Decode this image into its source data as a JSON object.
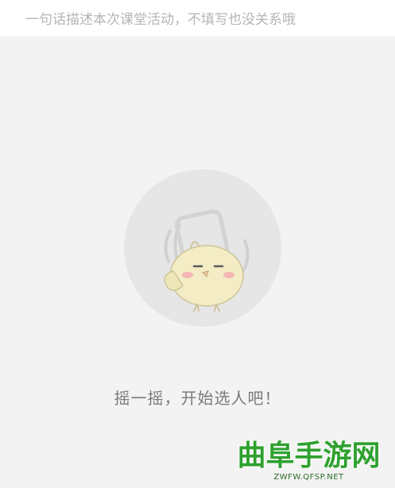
{
  "header": {
    "description_placeholder": "一句话描述本次课堂活动，不填写也没关系哦",
    "description_value": ""
  },
  "main": {
    "shake_icon": "shaking-chick-icon",
    "prompt_text": "摇一摇，开始选人吧！"
  },
  "watermark": {
    "title": "曲阜手游网",
    "url": "ZWFW.QFSP.NET"
  },
  "colors": {
    "background": "#f3f3f3",
    "header_background": "#ffffff",
    "circle": "#e6e6e6",
    "chick_body": "#f3ecc4",
    "cheek": "#f6b6b6",
    "prompt_text": "#7a7a7a",
    "watermark_green": "#2fa12f"
  }
}
